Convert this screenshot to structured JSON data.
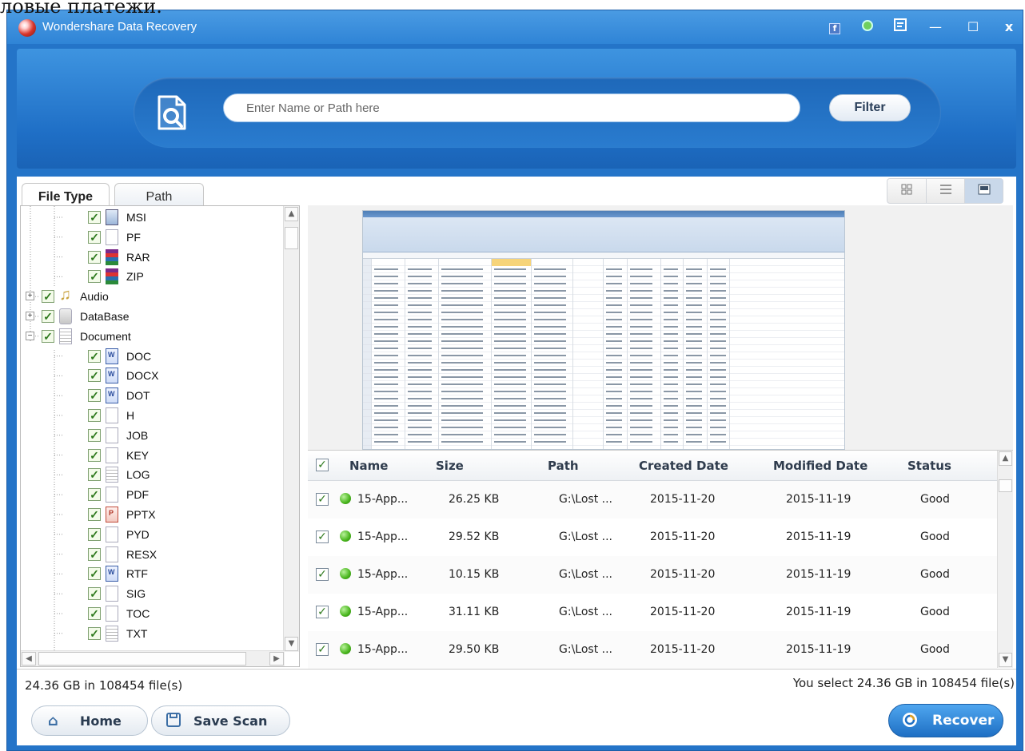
{
  "overlay_text": "ловые платежи.",
  "app": {
    "title": "Wondershare Data Recovery",
    "title_buttons": [
      "f",
      "",
      "",
      "—",
      "☐",
      "x"
    ]
  },
  "search": {
    "placeholder": "Enter Name or Path here",
    "filter_label": "Filter"
  },
  "tabs": {
    "file_type": "File Type",
    "path": "Path"
  },
  "tree": [
    {
      "label": "MSI",
      "level": 2,
      "icon": "msi"
    },
    {
      "label": "PF",
      "level": 2,
      "icon": "blank"
    },
    {
      "label": "RAR",
      "level": 2,
      "icon": "rar"
    },
    {
      "label": "ZIP",
      "level": 2,
      "icon": "rar"
    },
    {
      "label": "Audio",
      "level": 1,
      "icon": "audio",
      "expander": "+"
    },
    {
      "label": "DataBase",
      "level": 1,
      "icon": "db",
      "expander": "+"
    },
    {
      "label": "Document",
      "level": 1,
      "icon": "txt",
      "expander": "−"
    },
    {
      "label": "DOC",
      "level": 2,
      "icon": "word"
    },
    {
      "label": "DOCX",
      "level": 2,
      "icon": "word"
    },
    {
      "label": "DOT",
      "level": 2,
      "icon": "word"
    },
    {
      "label": "H",
      "level": 2,
      "icon": "blank"
    },
    {
      "label": "JOB",
      "level": 2,
      "icon": "blank"
    },
    {
      "label": "KEY",
      "level": 2,
      "icon": "blank"
    },
    {
      "label": "LOG",
      "level": 2,
      "icon": "txt"
    },
    {
      "label": "PDF",
      "level": 2,
      "icon": "blank"
    },
    {
      "label": "PPTX",
      "level": 2,
      "icon": "ppt"
    },
    {
      "label": "PYD",
      "level": 2,
      "icon": "blank"
    },
    {
      "label": "RESX",
      "level": 2,
      "icon": "blank"
    },
    {
      "label": "RTF",
      "level": 2,
      "icon": "word"
    },
    {
      "label": "SIG",
      "level": 2,
      "icon": "blank"
    },
    {
      "label": "TOC",
      "level": 2,
      "icon": "blank"
    },
    {
      "label": "TXT",
      "level": 2,
      "icon": "txt"
    }
  ],
  "table": {
    "columns": [
      "Name",
      "Size",
      "Path",
      "Created Date",
      "Modified Date",
      "Status"
    ],
    "rows": [
      {
        "name": "15-App...",
        "size": "26.25 KB",
        "path": "G:\\Lost ...",
        "created": "2015-11-20",
        "modified": "2015-11-19",
        "status": "Good"
      },
      {
        "name": "15-App...",
        "size": "29.52 KB",
        "path": "G:\\Lost ...",
        "created": "2015-11-20",
        "modified": "2015-11-19",
        "status": "Good"
      },
      {
        "name": "15-App...",
        "size": "10.15 KB",
        "path": "G:\\Lost ...",
        "created": "2015-11-20",
        "modified": "2015-11-19",
        "status": "Good"
      },
      {
        "name": "15-App...",
        "size": "31.11 KB",
        "path": "G:\\Lost ...",
        "created": "2015-11-20",
        "modified": "2015-11-19",
        "status": "Good"
      },
      {
        "name": "15-App...",
        "size": "29.50 KB",
        "path": "G:\\Lost ...",
        "created": "2015-11-20",
        "modified": "2015-11-19",
        "status": "Good"
      }
    ]
  },
  "status": {
    "left": "24.36 GB in 108454 file(s)",
    "right": "You select 24.36 GB in 108454 file(s)"
  },
  "buttons": {
    "home": "Home",
    "save_scan": "Save Scan",
    "recover": "Recover"
  },
  "colors": {
    "accent": "#2474c8",
    "status_good": "#48b51c"
  }
}
